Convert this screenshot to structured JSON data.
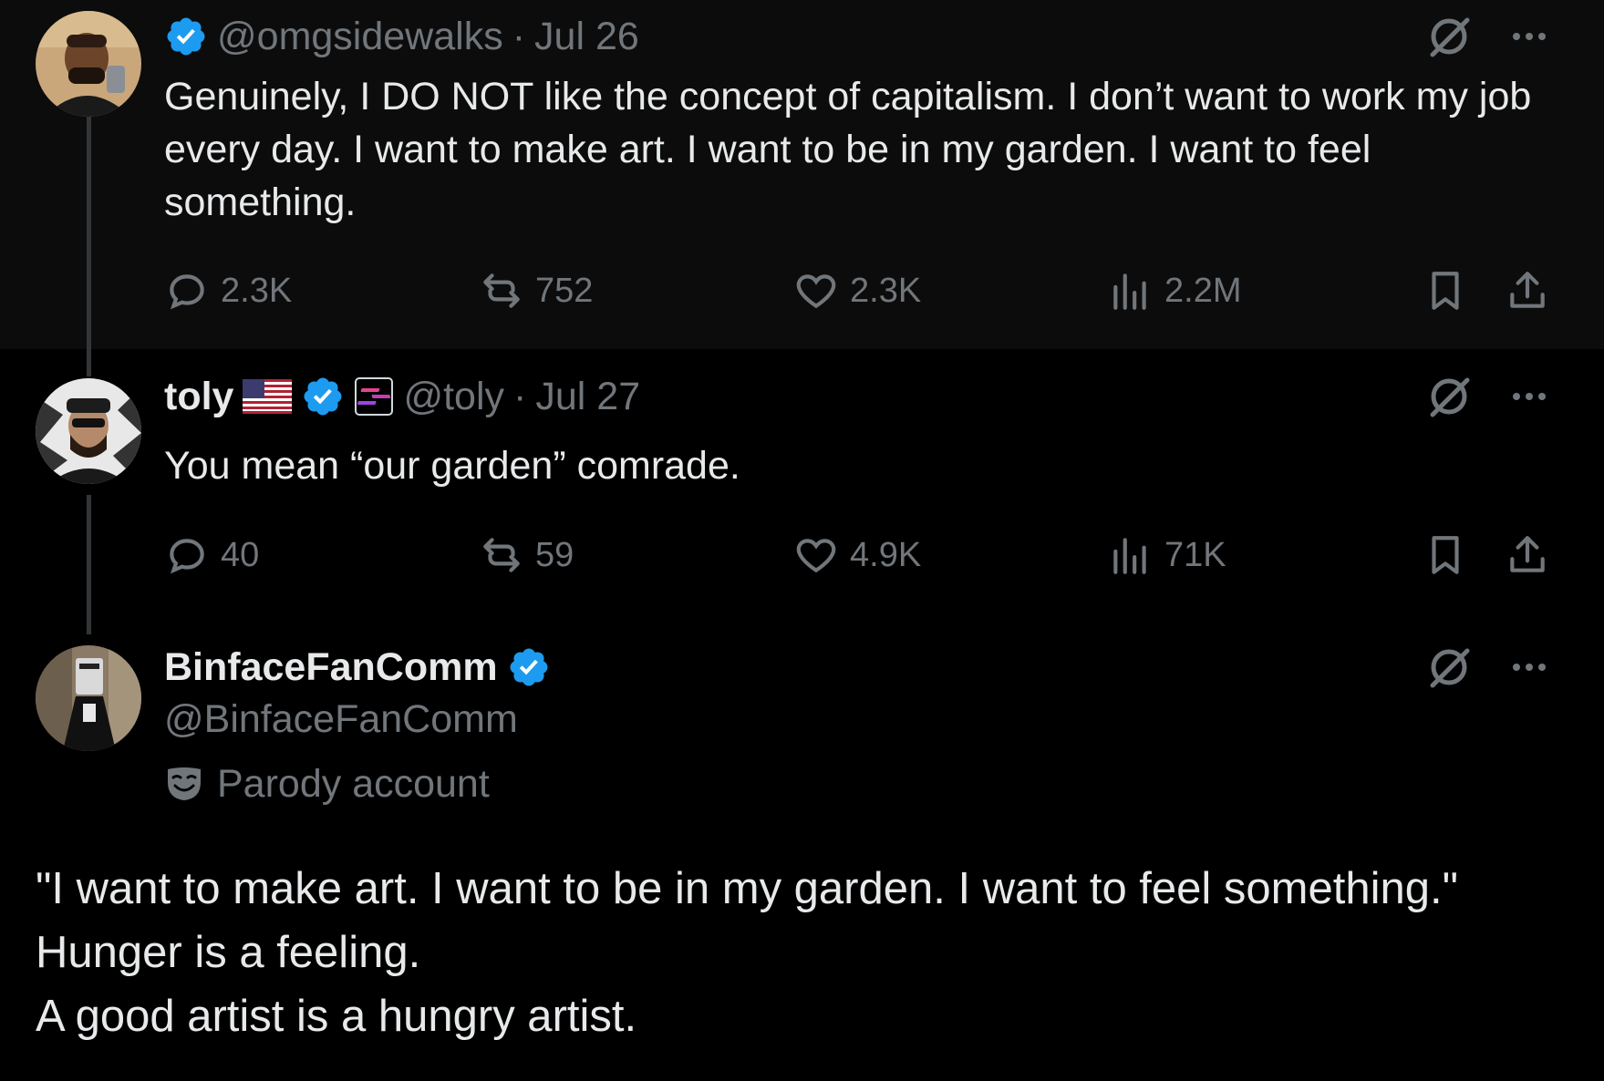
{
  "tweets": [
    {
      "handle": "@omgsidewalks",
      "date": "Jul 26",
      "text": "Genuinely, I DO NOT like the concept of capitalism. I don’t want to work my job every day. I want to make art. I want to be in my garden. I want to feel something.",
      "replies": "2.3K",
      "reposts": "752",
      "likes": "2.3K",
      "views": "2.2M"
    },
    {
      "name": "toly",
      "handle": "@toly",
      "date": "Jul 27",
      "text": "You mean “our garden” comrade.",
      "replies": "40",
      "reposts": "59",
      "likes": "4.9K",
      "views": "71K"
    },
    {
      "name": "BinfaceFanComm",
      "handle": "@BinfaceFanComm",
      "label": "Parody account",
      "text_lines": [
        "\"I want to make art. I want to be in my garden. I want to feel something.\"",
        "Hunger is a feeling.",
        "A good artist is a hungry artist."
      ]
    }
  ],
  "separator": "·",
  "colors": {
    "background": "#000000",
    "muted": "#71767b",
    "text": "#e7e9ea",
    "verified": "#1d9bf0"
  },
  "icons": [
    "verified-icon",
    "grok-icon",
    "more-icon",
    "reply-icon",
    "repost-icon",
    "like-icon",
    "views-icon",
    "bookmark-icon",
    "share-icon",
    "flag-icon",
    "affiliate-badge-icon",
    "parody-mask-icon"
  ]
}
